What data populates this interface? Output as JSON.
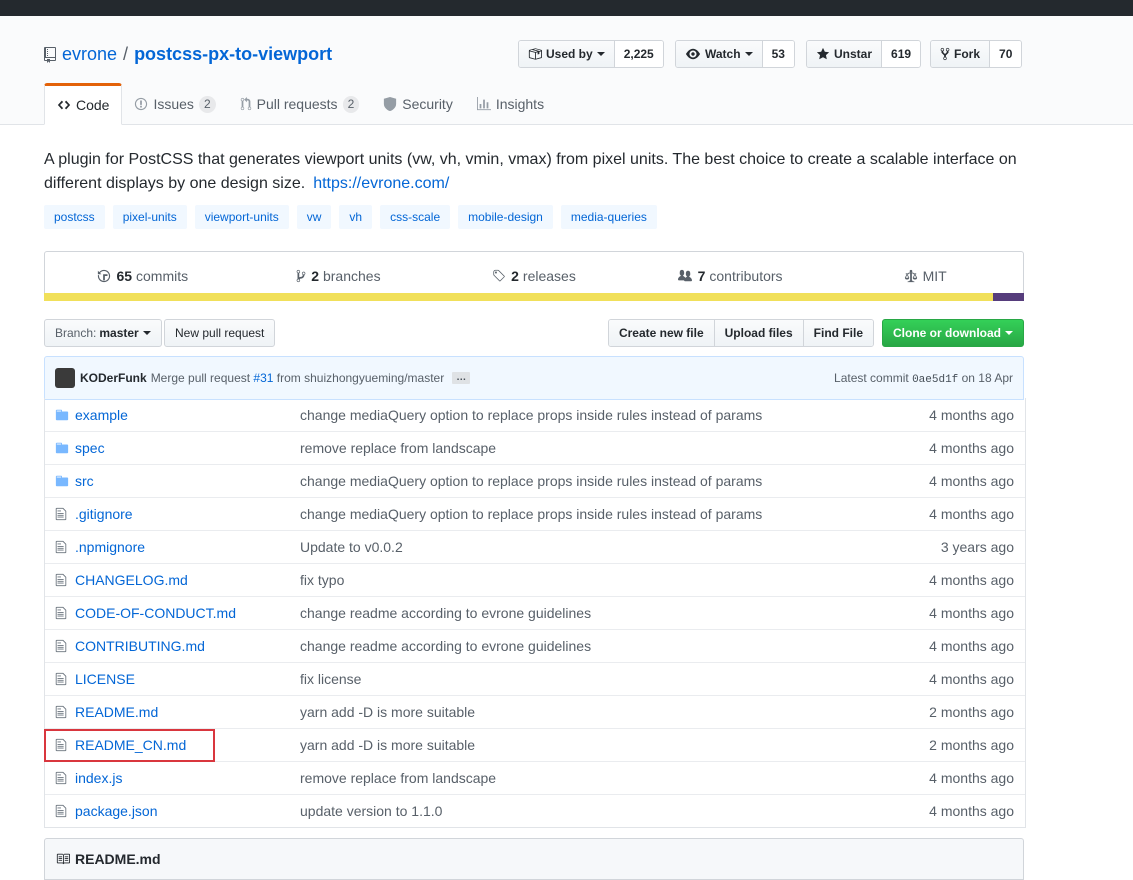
{
  "repo": {
    "owner": "evrone",
    "separator": "/",
    "name": "postcss-px-to-viewport"
  },
  "actions": {
    "used_by": {
      "label": "Used by",
      "count": "2,225"
    },
    "watch": {
      "label": "Watch",
      "count": "53"
    },
    "star": {
      "label": "Unstar",
      "count": "619"
    },
    "fork": {
      "label": "Fork",
      "count": "70"
    }
  },
  "tabs": [
    {
      "label": "Code",
      "counter": ""
    },
    {
      "label": "Issues",
      "counter": "2"
    },
    {
      "label": "Pull requests",
      "counter": "2"
    },
    {
      "label": "Security",
      "counter": ""
    },
    {
      "label": "Insights",
      "counter": ""
    }
  ],
  "description": "A plugin for PostCSS that generates viewport units (vw, vh, vmin, vmax) from pixel units. The best choice to create a scalable interface on different displays by one design size.",
  "homepage": "https://evrone.com/",
  "topics": [
    "postcss",
    "pixel-units",
    "viewport-units",
    "vw",
    "vh",
    "css-scale",
    "mobile-design",
    "media-queries"
  ],
  "summary": {
    "commits": {
      "count": "65",
      "label": "commits"
    },
    "branches": {
      "count": "2",
      "label": "branches"
    },
    "releases": {
      "count": "2",
      "label": "releases"
    },
    "contributors": {
      "count": "7",
      "label": "contributors"
    },
    "license": "MIT"
  },
  "colors": {
    "lang_primary": "#f1e05a",
    "lang_secondary": "#563d7c",
    "accent": "#0366d6",
    "highlight": "#d9363e"
  },
  "file_nav": {
    "branch_prefix": "Branch:",
    "branch": "master",
    "new_pr": "New pull request",
    "create_file": "Create new file",
    "upload": "Upload files",
    "find": "Find File",
    "clone": "Clone or download"
  },
  "commit": {
    "author": "KODerFunk",
    "message_prefix": "Merge pull request",
    "pr_link": "#31",
    "message_suffix": "from shuizhongyueming/master",
    "ellipsis": "…",
    "latest_label": "Latest commit",
    "sha": "0ae5d1f",
    "date": "on 18 Apr"
  },
  "files": [
    {
      "type": "dir",
      "name": "example",
      "message": "change mediaQuery option to replace props inside rules instead of params",
      "age": "4 months ago"
    },
    {
      "type": "dir",
      "name": "spec",
      "message": "remove replace from landscape",
      "age": "4 months ago"
    },
    {
      "type": "dir",
      "name": "src",
      "message": "change mediaQuery option to replace props inside rules instead of params",
      "age": "4 months ago"
    },
    {
      "type": "file",
      "name": ".gitignore",
      "message": "change mediaQuery option to replace props inside rules instead of params",
      "age": "4 months ago"
    },
    {
      "type": "file",
      "name": ".npmignore",
      "message": "Update to v0.0.2",
      "age": "3 years ago"
    },
    {
      "type": "file",
      "name": "CHANGELOG.md",
      "message": "fix typo",
      "age": "4 months ago"
    },
    {
      "type": "file",
      "name": "CODE-OF-CONDUCT.md",
      "message": "change readme according to evrone guidelines",
      "age": "4 months ago"
    },
    {
      "type": "file",
      "name": "CONTRIBUTING.md",
      "message": "change readme according to evrone guidelines",
      "age": "4 months ago"
    },
    {
      "type": "file",
      "name": "LICENSE",
      "message": "fix license",
      "age": "4 months ago"
    },
    {
      "type": "file",
      "name": "README.md",
      "message": "yarn add -D is more suitable",
      "age": "2 months ago"
    },
    {
      "type": "file",
      "name": "README_CN.md",
      "message": "yarn add -D is more suitable",
      "age": "2 months ago"
    },
    {
      "type": "file",
      "name": "index.js",
      "message": "remove replace from landscape",
      "age": "4 months ago"
    },
    {
      "type": "file",
      "name": "package.json",
      "message": "update version to 1.1.0",
      "age": "4 months ago"
    }
  ],
  "readme_header": "README.md"
}
